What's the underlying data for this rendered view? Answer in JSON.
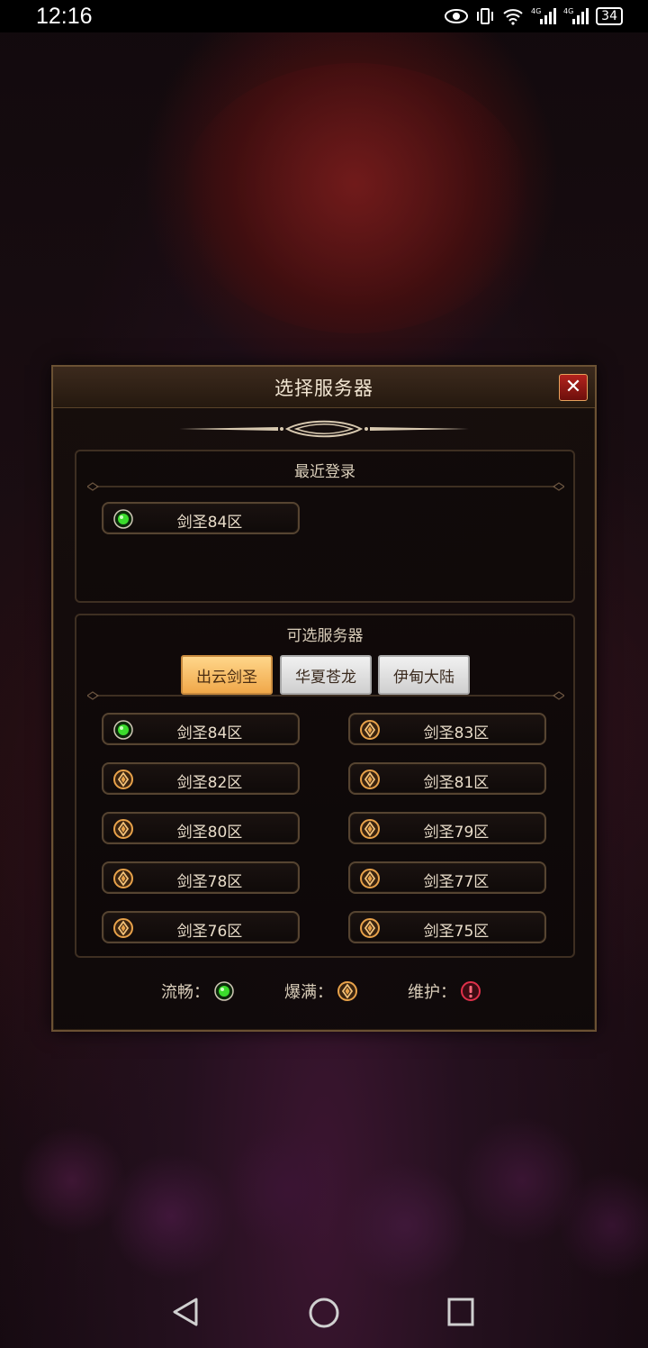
{
  "status_bar": {
    "time": "12:16",
    "network_1": "4G",
    "network_2": "4G",
    "battery": "34"
  },
  "dialog": {
    "title": "选择服务器",
    "recent": {
      "title": "最近登录",
      "servers": [
        {
          "name": "剑圣84区",
          "status": "smooth"
        }
      ]
    },
    "available": {
      "title": "可选服务器",
      "tabs": [
        {
          "label": "出云剑圣",
          "active": true
        },
        {
          "label": "华夏苍龙",
          "active": false
        },
        {
          "label": "伊甸大陆",
          "active": false
        }
      ],
      "servers": [
        {
          "name": "剑圣84区",
          "status": "smooth"
        },
        {
          "name": "剑圣83区",
          "status": "full"
        },
        {
          "name": "剑圣82区",
          "status": "full"
        },
        {
          "name": "剑圣81区",
          "status": "full"
        },
        {
          "name": "剑圣80区",
          "status": "full"
        },
        {
          "name": "剑圣79区",
          "status": "full"
        },
        {
          "name": "剑圣78区",
          "status": "full"
        },
        {
          "name": "剑圣77区",
          "status": "full"
        },
        {
          "name": "剑圣76区",
          "status": "full"
        },
        {
          "name": "剑圣75区",
          "status": "full"
        }
      ]
    },
    "legend": {
      "smooth_label": "流畅：",
      "full_label": "爆满：",
      "maintenance_label": "维护："
    }
  },
  "colors": {
    "smooth": "#3bdc2c",
    "full": "#e8a24a",
    "maintenance": "#e0304a",
    "tab_active": "#f7c46b"
  }
}
